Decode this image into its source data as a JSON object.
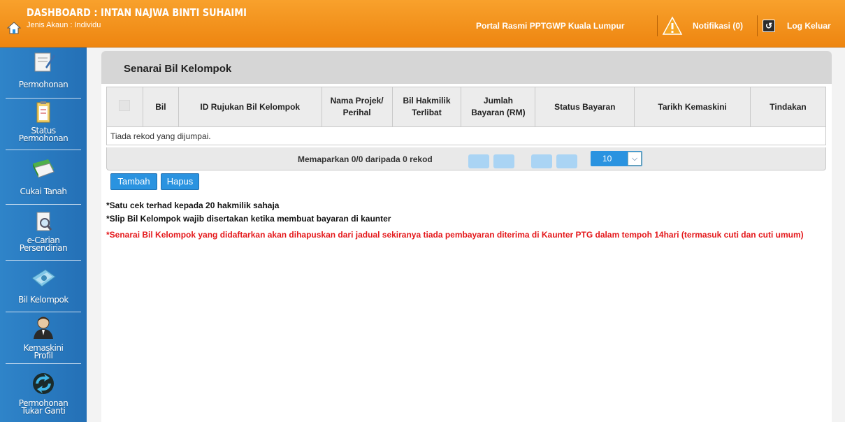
{
  "header": {
    "title": "DASHBOARD : INTAN NAJWA BINTI SUHAIMI",
    "subtitle": "Jenis Akaun : Individu",
    "portal": "Portal Rasmi PPTGWP Kuala Lumpur",
    "notifications": "Notifikasi (0)",
    "logout": "Log Keluar"
  },
  "sidebar": {
    "items": [
      {
        "label": "Permohonan",
        "icon": "document-icon"
      },
      {
        "label": "Status",
        "label2": "Permohonan",
        "icon": "clipboard-icon"
      },
      {
        "label": "Cukai Tanah",
        "icon": "book-icon"
      },
      {
        "label": "e-Carian",
        "label2": "Persendirian",
        "icon": "search-document-icon"
      },
      {
        "label": "Bil Kelompok",
        "icon": "money-icon"
      },
      {
        "label": "Kemaskini",
        "label2": "Profil",
        "icon": "user-icon"
      },
      {
        "label": "Permohonan",
        "label2": "Tukar Ganti",
        "icon": "exchange-icon"
      }
    ]
  },
  "main": {
    "title": "Senarai Bil Kelompok",
    "columns": {
      "bil": "Bil",
      "id": "ID Rujukan Bil Kelompok",
      "nama1": "Nama Projek/",
      "nama2": "Perihal",
      "hakmilik1": "Bil Hakmilik",
      "hakmilik2": "Terlibat",
      "jumlah1": "Jumlah",
      "jumlah2": "Bayaran (RM)",
      "status": "Status Bayaran",
      "tarikh": "Tarikh Kemaskini",
      "tindakan": "Tindakan"
    },
    "empty_message": "Tiada rekod yang dijumpai.",
    "pager_text": "Memaparkan 0/0 daripada 0 rekod",
    "page_size": "10",
    "buttons": {
      "add": "Tambah",
      "delete": "Hapus"
    },
    "notes": {
      "n1": "*Satu cek terhad kepada 20 hakmilik sahaja",
      "n2": "*Slip Bil Kelompok wajib disertakan ketika membuat bayaran di kaunter",
      "n3": "*Senarai Bil Kelompok yang didaftarkan akan dihapuskan dari jadual sekiranya tiada pembayaran diterima di Kaunter PTG dalam tempoh 14hari (termasuk cuti dan cuti umum)"
    }
  },
  "colors": {
    "header": "#ee8510",
    "sidebar": "#2a78bf",
    "button": "#2a93e0",
    "warning_text": "#e4181b"
  }
}
